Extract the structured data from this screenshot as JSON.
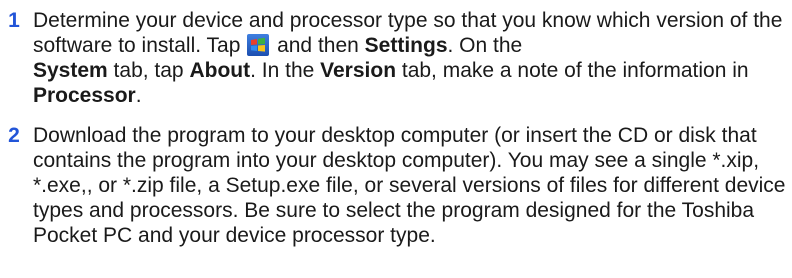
{
  "steps": [
    {
      "number": "1",
      "parts": {
        "p1": "Determine your device and processor type so that you know which version of the software to install. Tap ",
        "p2": " and then ",
        "settings": "Settings",
        "p3": ". On the ",
        "system": "System",
        "p4": " tab, tap ",
        "about": "About",
        "p5": ". In the ",
        "version": "Version",
        "p6": " tab, make a note of the information in ",
        "processor": "Processor",
        "p7": "."
      },
      "icon": "windows-start-icon"
    },
    {
      "number": "2",
      "text": "Download the program to your desktop computer (or insert the CD or disk that contains the program into your desktop computer). You may see a single *.xip, *.exe,, or *.zip file, a Setup.exe file, or several versions of files for different device types and processors. Be sure to select the program designed for the Toshiba Pocket PC and your device processor type."
    }
  ],
  "colors": {
    "step_number": "#2255d8",
    "text": "#1a1a1a"
  }
}
